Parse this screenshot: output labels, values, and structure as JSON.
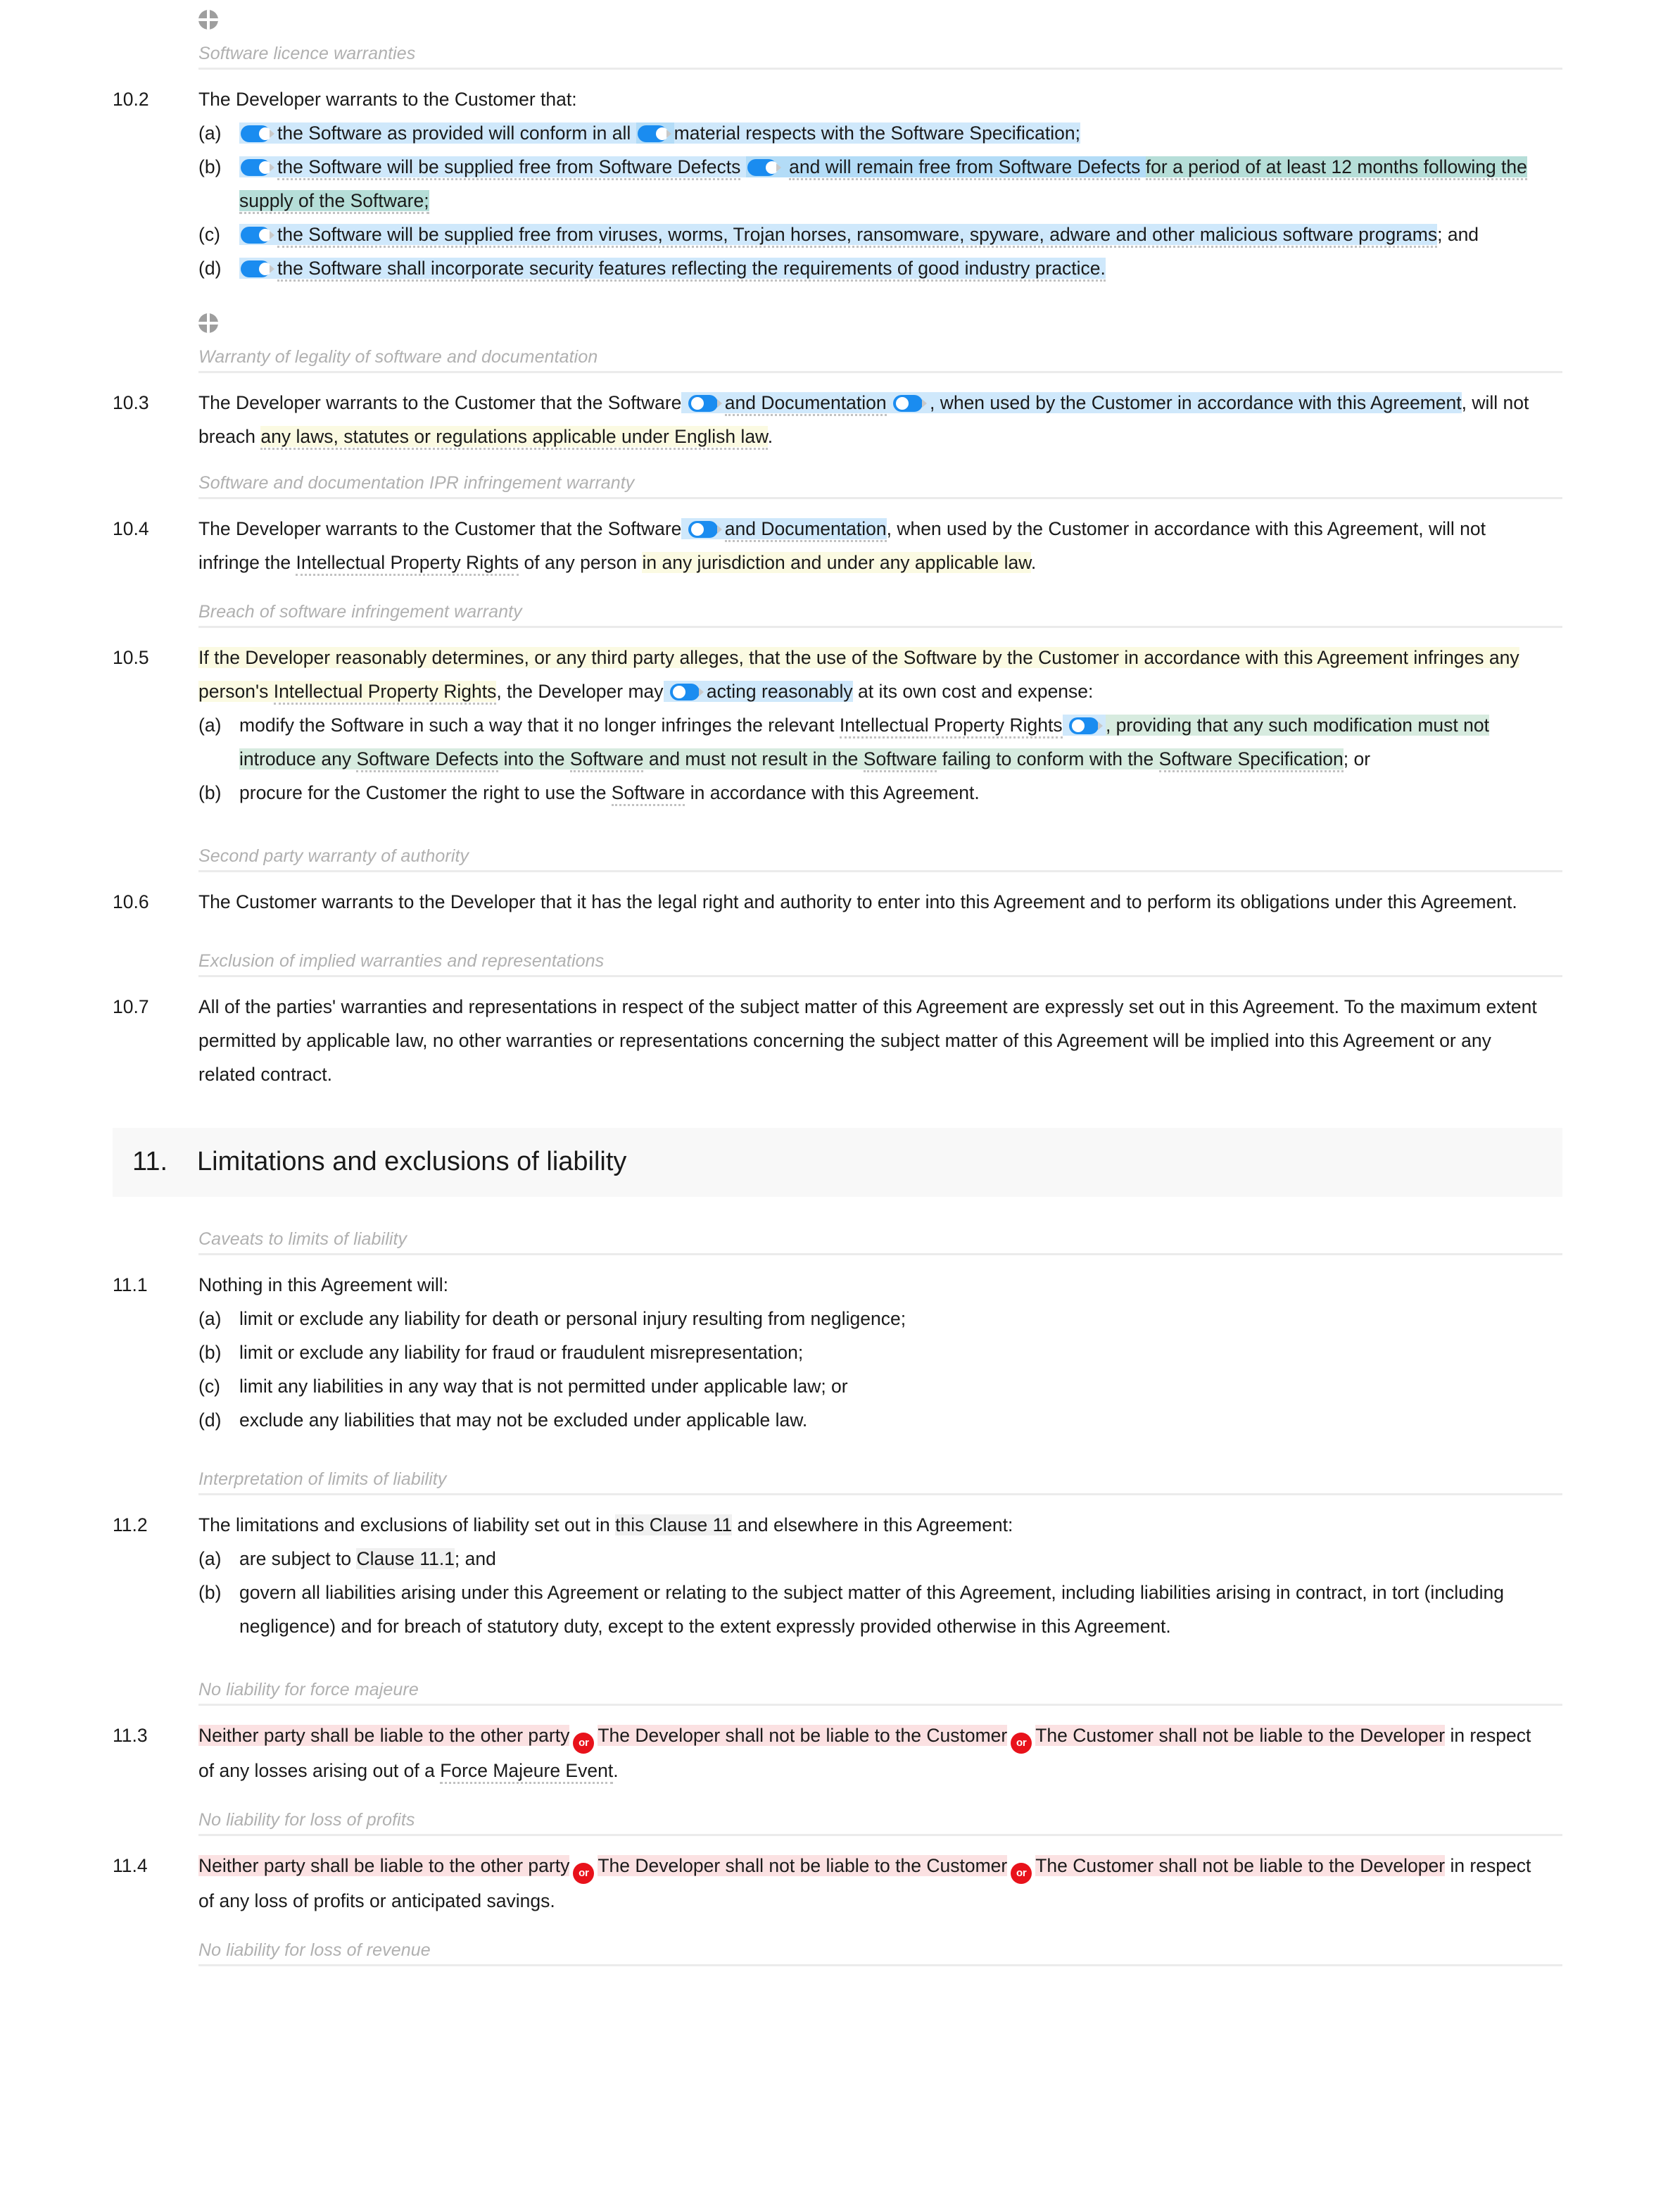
{
  "document": {
    "icons": {
      "quadrant": "quadrant-circle-icon",
      "toggle_on": "toggle-switch-on-icon",
      "toggle_off": "toggle-switch-off-icon",
      "or_badge": "or-alternative-badge"
    },
    "colors": {
      "toggle_track": "#1a8cf0",
      "or_badge": "#e8121b",
      "highlight_blue": "#cfe8fb",
      "highlight_blue_strong": "#b3dcf7",
      "highlight_teal": "#b6ded8",
      "highlight_green": "#d7ebdf",
      "highlight_cream": "#fbfae2",
      "highlight_pink": "#fbe1e2",
      "highlight_grey": "#f0f0f0",
      "subheading": "#b0b0b0",
      "rule": "#ebebeb",
      "section_banner_bg": "#f8f8f8"
    }
  },
  "headings": {
    "software_licence_warranties": "Software licence warranties",
    "warranty_of_legality": "Warranty of legality of software and documentation",
    "ipr_infringement": "Software and documentation IPR infringement warranty",
    "breach_of_software": "Breach of software infringement warranty",
    "second_party_warranty": "Second party warranty of authority",
    "exclusion_implied": "Exclusion of implied warranties and representations",
    "caveats_limits": "Caveats to limits of liability",
    "interpretation_limits": "Interpretation of limits of liability",
    "force_majeure": "No liability for force majeure",
    "loss_of_profits": "No liability for loss of profits",
    "loss_of_revenue": "No liability for loss of revenue"
  },
  "section11": {
    "number": "11.",
    "title": "Limitations and exclusions of liability"
  },
  "clauses": {
    "c10_2": {
      "num": "10.2",
      "lead": "The Developer warrants to the Customer that:",
      "a": {
        "label": "(a)",
        "t1": "the Software as provided will conform in all",
        "t2": "material respects with the Software Specification;"
      },
      "b": {
        "label": "(b)",
        "t1": "the Software will be supplied free from Software Defects",
        "t2": "and will remain free from Software Defects",
        "t3": "for a period of at least 12 months following the supply of the Software;"
      },
      "c": {
        "label": "(c)",
        "t1": "the Software will be supplied free from viruses, worms, Trojan horses, ransomware, spyware, adware and other malicious software programs",
        "t2": "; and"
      },
      "d": {
        "label": "(d)",
        "t1": "the Software shall incorporate security features reflecting the requirements of good industry practice."
      }
    },
    "c10_3": {
      "num": "10.3",
      "t1": "The Developer warrants to the Customer that the Software",
      "t2": "and Documentation",
      "t3": ", when used by the Customer in accordance with this Agreement",
      "t4": ", will not breach ",
      "t5": "any laws, statutes or regulations applicable under English law",
      "t6": "."
    },
    "c10_4": {
      "num": "10.4",
      "t1": "The Developer warrants to the Customer that the Software",
      "t2": "and Documentation",
      "t3": ", when used by the Customer in accordance with this Agreement, will not infringe the ",
      "t4": "Intellectual Property Rights",
      "t5": " of any person ",
      "t6": "in any jurisdiction and under any applicable law",
      "t7": "."
    },
    "c10_5": {
      "num": "10.5",
      "t1": "If the Developer reasonably determines, or any third party alleges, that the use of the Software by the Customer in accordance with this Agreement infringes any person's ",
      "t2": "Intellectual Property Rights",
      "t3": ", the Developer may",
      "t4": "acting reasonably",
      "t5": " at its own cost and expense:",
      "a": {
        "label": "(a)",
        "t1": "modify the Software in such a way that it no longer infringes the relevant ",
        "t2": "Intellectual Property Rights",
        "t3": ", providing that any such modification must not introduce any ",
        "t4": "Software Defects",
        "t5": " into the ",
        "t6": "Software",
        "t7": " and must not result in the ",
        "t8": "Software",
        "t9": " failing to conform with the ",
        "t10": "Software Specification",
        "t11": "; or"
      },
      "b": {
        "label": "(b)",
        "t1": "procure for the Customer the right to use the ",
        "t2": "Software",
        "t3": " in accordance with this Agreement."
      }
    },
    "c10_6": {
      "num": "10.6",
      "t1": "The Customer warrants to the Developer that it has the legal right and authority to enter into this Agreement and to perform its obligations under this Agreement."
    },
    "c10_7": {
      "num": "10.7",
      "t1": "All of the parties' warranties and representations in respect of the subject matter of this Agreement are expressly set out in this Agreement. To the maximum extent permitted by applicable law, no other warranties or representations concerning the subject matter of this Agreement will be implied into this Agreement or any related contract."
    },
    "c11_1": {
      "num": "11.1",
      "lead": "Nothing in this Agreement will:",
      "a": {
        "label": "(a)",
        "t1": "limit or exclude any liability for death or personal injury resulting from negligence;"
      },
      "b": {
        "label": "(b)",
        "t1": "limit or exclude any liability for fraud or fraudulent misrepresentation;"
      },
      "c": {
        "label": "(c)",
        "t1": "limit any liabilities in any way that is not permitted under applicable law; or"
      },
      "d": {
        "label": "(d)",
        "t1": "exclude any liabilities that may not be excluded under applicable law."
      }
    },
    "c11_2": {
      "num": "11.2",
      "t1": "The limitations and exclusions of liability set out in ",
      "t2": "this Clause 11",
      "t3": " and elsewhere in this Agreement:",
      "a": {
        "label": "(a)",
        "t1": "are subject to ",
        "t2": "Clause 11.1",
        "t3": "; and"
      },
      "b": {
        "label": "(b)",
        "t1": "govern all liabilities arising under this Agreement or relating to the subject matter of this Agreement, including liabilities arising in contract, in tort (including negligence) and for breach of statutory duty, except to the extent expressly provided otherwise in this Agreement."
      }
    },
    "c11_3": {
      "num": "11.3",
      "opt1": "Neither party shall be liable to the other party",
      "or": "or",
      "opt2": "The Developer shall not be liable to the Customer",
      "opt3": "The Customer shall not be liable to the Developer",
      "tail1": " in respect of any losses arising out of a ",
      "tail2": "Force Majeure Event",
      "tail3": "."
    },
    "c11_4": {
      "num": "11.4",
      "opt1": "Neither party shall be liable to the other party",
      "or": "or",
      "opt2": "The Developer shall not be liable to the Customer",
      "opt3": "The Customer shall not be liable to the Developer",
      "tail1": " in respect of any loss of profits or anticipated savings."
    }
  }
}
